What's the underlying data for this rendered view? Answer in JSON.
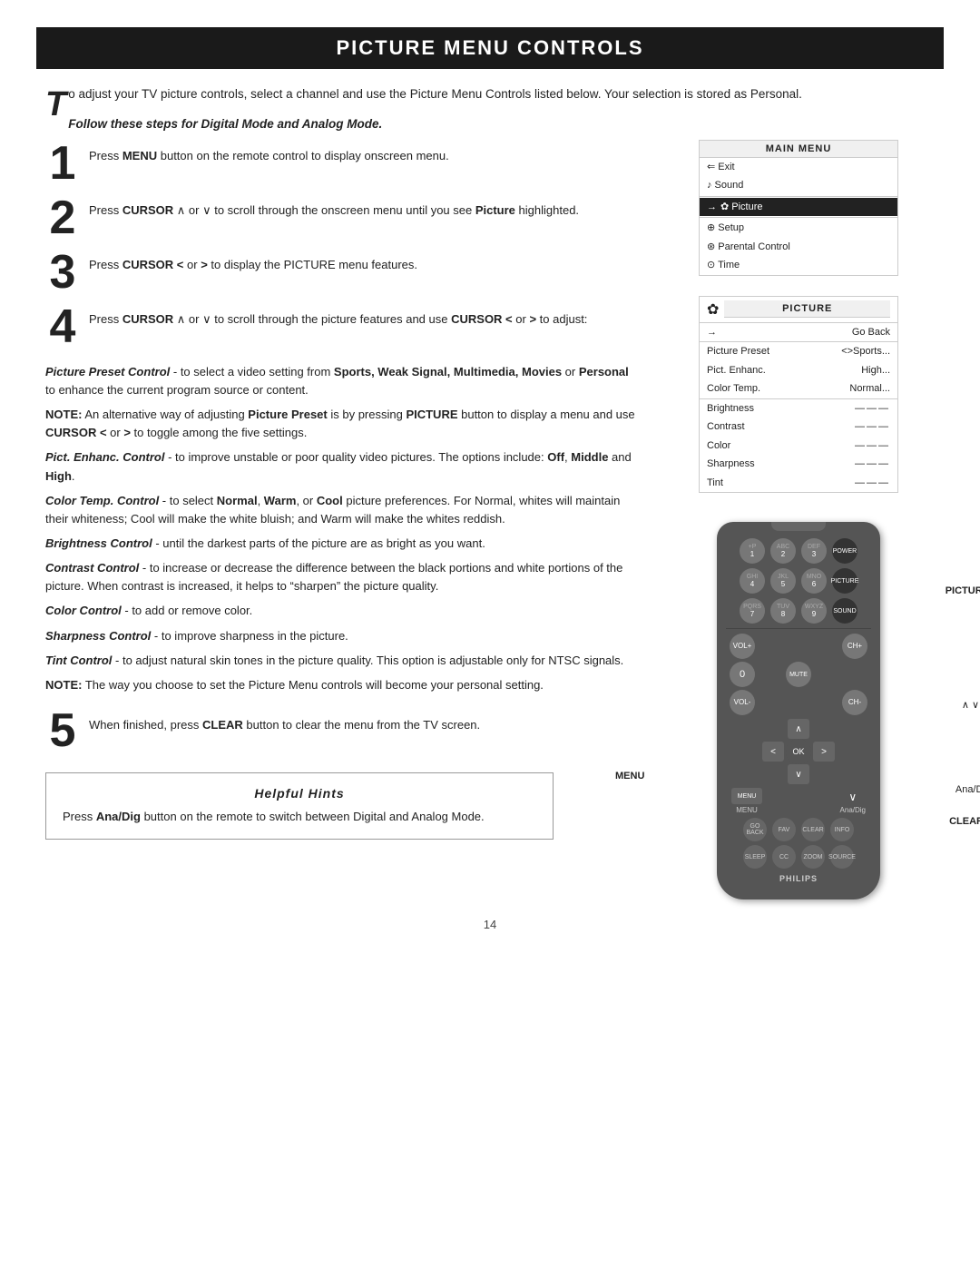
{
  "page": {
    "title": "PICTURE MENU CONTROLS",
    "page_number": "14"
  },
  "intro": {
    "drop_cap": "T",
    "text": "o adjust your TV picture controls, select a channel and use the Picture Menu Controls listed below. Your selection is stored as Personal."
  },
  "follow_steps": "Follow these steps for Digital Mode and Analog Mode.",
  "steps": [
    {
      "number": "1",
      "text": "Press MENU button on the remote control to display onscreen menu."
    },
    {
      "number": "2",
      "text": "Press CURSOR ∧ or ∨ to scroll through the onscreen menu until you see Picture highlighted."
    },
    {
      "number": "3",
      "text": "Press CURSOR < or > to display the PICTURE menu features."
    },
    {
      "number": "4",
      "text": "Press CURSOR ∧ or ∨ to scroll through the picture features and use CURSOR < or > to adjust:"
    }
  ],
  "descriptions": [
    {
      "id": "picture-preset",
      "label": "Picture Preset Control",
      "text": "- to select a video setting from Sports, Weak Signal, Multimedia, Movies or Personal to enhance the current program source or content."
    },
    {
      "id": "note-picture-preset",
      "text": "NOTE: An alternative way of adjusting Picture Preset is by pressing PICTURE button to display a menu and use CURSOR < or > to toggle among the five settings."
    },
    {
      "id": "pict-enhanc",
      "label": "Pict. Enhanc. Control",
      "text": "- to improve unstable or poor quality video pictures. The options include: Off, Middle and High."
    },
    {
      "id": "color-temp",
      "label": "Color Temp. Control",
      "text": "- to select Normal, Warm, or Cool picture preferences. For Normal, whites will maintain their whiteness; Cool will make the white bluish; and Warm will make the whites reddish."
    },
    {
      "id": "brightness",
      "label": "Brightness Control",
      "text": "- until the darkest parts of the picture are as bright as you want."
    },
    {
      "id": "contrast",
      "label": "Contrast Control",
      "text": "- to increase or decrease the difference between the black portions and white portions of the picture. When contrast is increased, it helps to \"sharpen\" the picture quality."
    },
    {
      "id": "color",
      "label": "Color Control",
      "text": "- to add or remove color."
    },
    {
      "id": "sharpness",
      "label": "Sharpness Control",
      "text": "- to improve sharpness in the picture."
    },
    {
      "id": "tint",
      "label": "Tint Control",
      "text": "- to adjust natural skin tones in the picture quality. This option is adjustable only for NTSC signals."
    },
    {
      "id": "note-personal",
      "text": "NOTE: The way you choose to set the Picture Menu controls will become your personal setting."
    }
  ],
  "step5": {
    "number": "5",
    "text": "When finished, press CLEAR button to clear the menu from the TV screen."
  },
  "helpful_hints": {
    "title": "Helpful Hints",
    "text": "Press Ana/Dig button on the remote to switch between Digital and Analog Mode."
  },
  "main_menu": {
    "title": "MAIN MENU",
    "items": [
      {
        "label": "⇐ Exit",
        "selected": false,
        "arrow": false
      },
      {
        "label": "♪ Sound",
        "selected": false,
        "arrow": false
      },
      {
        "label": "✿ Picture",
        "selected": true,
        "arrow": true
      },
      {
        "label": "⊕ Setup",
        "selected": false,
        "arrow": false
      },
      {
        "label": "⊛ Parental Control",
        "selected": false,
        "arrow": false
      },
      {
        "label": "⊙ Time",
        "selected": false,
        "arrow": false
      }
    ]
  },
  "picture_menu": {
    "title": "PICTURE",
    "icon": "✿",
    "items": [
      {
        "label": "Go Back",
        "value": "",
        "arrow": true
      },
      {
        "label": "Picture Preset",
        "value": "<>Sports...",
        "arrow": true
      },
      {
        "label": "Pict. Enhanc.",
        "value": "High...",
        "arrow": false
      },
      {
        "label": "Color Temp.",
        "value": "Normal...",
        "arrow": false
      },
      {
        "label": "Brightness",
        "value": "——",
        "arrow": false
      },
      {
        "label": "Contrast",
        "value": "——",
        "arrow": false
      },
      {
        "label": "Color",
        "value": "——",
        "arrow": false
      },
      {
        "label": "Sharpness",
        "value": "——",
        "arrow": false
      },
      {
        "label": "Tint",
        "value": "——",
        "arrow": false
      }
    ]
  },
  "remote": {
    "label_picture": "PICTURE",
    "label_menu": "MENU",
    "label_anadig": "Ana/Dig",
    "label_clear": "CLEAR",
    "label_cursors": "∧ ∨ < >",
    "brand": "PHILIPS",
    "rows": [
      [
        {
          "top": "+P",
          "main": "1"
        },
        {
          "top": "ABC",
          "main": "2"
        },
        {
          "top": "DEF",
          "main": "3"
        },
        {
          "top": "",
          "main": "POWER",
          "wide": false,
          "dark": false
        }
      ],
      [
        {
          "top": "GHI",
          "main": "4"
        },
        {
          "top": "JKL",
          "main": "5"
        },
        {
          "top": "MNO",
          "main": "6"
        },
        {
          "top": "",
          "main": "PICTURE",
          "wide": false,
          "dark": false
        }
      ],
      [
        {
          "top": "PQRS",
          "main": "7"
        },
        {
          "top": "TUV",
          "main": "8"
        },
        {
          "top": "WXYZ",
          "main": "9"
        },
        {
          "top": "",
          "main": "SOUND",
          "wide": false,
          "dark": false
        }
      ]
    ],
    "vol_label": "VOL+",
    "vol_down_label": "VOL-",
    "ch_label": "CH+",
    "ch_down_label": "CH-",
    "zero_btn": "0",
    "mute_btn": "MUTE",
    "nav_up": "∧",
    "nav_down": "∨",
    "nav_left": "<",
    "nav_right": ">",
    "nav_ok": "OK",
    "menu_btn": "MENU",
    "anadig_btn": "Ana/Dig",
    "go_back_btn": "GO BACK",
    "fav_btn": "FAV",
    "clear_btn": "CLEAR",
    "info_btn": "INFO",
    "sleep_btn": "SLEEP",
    "cc_btn": "CC",
    "zoom_btn": "ZOOM",
    "source_btn": "SOURCE"
  }
}
